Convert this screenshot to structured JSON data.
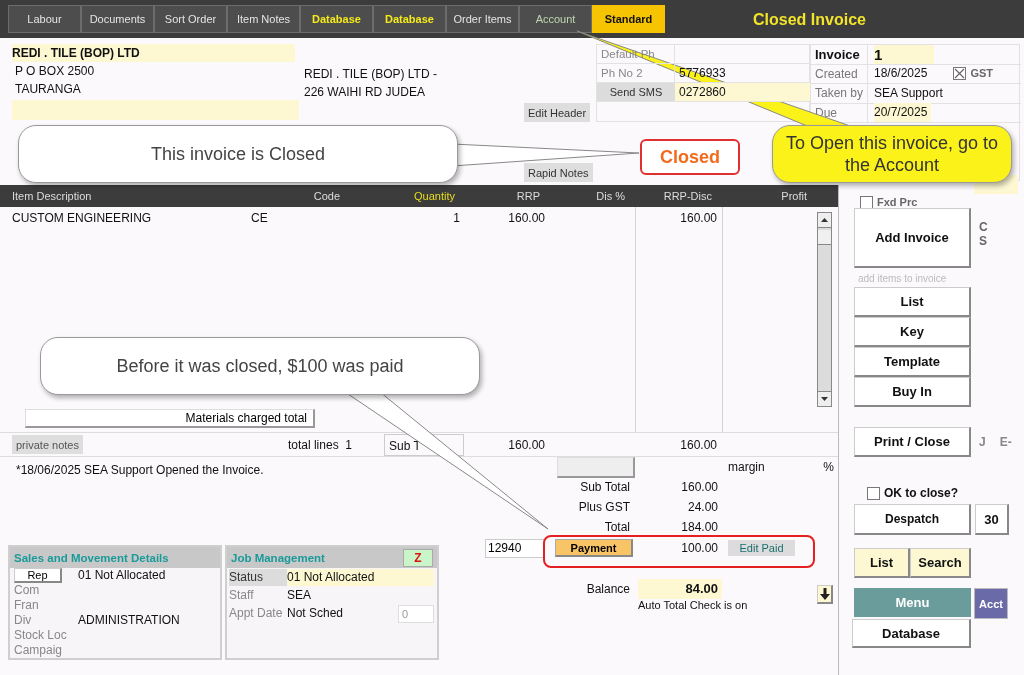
{
  "window": {
    "title": "Closed Invoice"
  },
  "tabs": [
    {
      "label": "Labour",
      "kind": "normal",
      "selected": false
    },
    {
      "label": "Documents",
      "kind": "normal",
      "selected": false
    },
    {
      "label": "Sort Order",
      "kind": "normal",
      "selected": false
    },
    {
      "label": "Item Notes",
      "kind": "normal",
      "selected": false
    },
    {
      "label": "Database",
      "kind": "database",
      "selected": false
    },
    {
      "label": "Database",
      "kind": "database",
      "selected": false
    },
    {
      "label": "Order Items",
      "kind": "normal",
      "selected": false
    },
    {
      "label": "Account",
      "kind": "account",
      "selected": false
    },
    {
      "label": "Standard",
      "kind": "normal",
      "selected": true
    }
  ],
  "customer": {
    "name": "REDI . TILE (BOP) LTD",
    "address_lines": [
      "P O BOX 2500",
      "TAURANGA"
    ],
    "site_lines": [
      "REDI . TILE (BOP) LTD -",
      "226 WAIHI RD JUDEA"
    ]
  },
  "header_buttons": [
    "Edit Header",
    "Rapid Notes"
  ],
  "phones": [
    {
      "label": "Default Ph",
      "kind": "label"
    },
    {
      "label": "Ph No 2",
      "value": "5776933",
      "kind": "label"
    },
    {
      "label": "Send SMS",
      "value": "0272860",
      "kind": "button"
    }
  ],
  "invoice_fields": [
    {
      "label": "Invoice",
      "value": "1",
      "kind": "key",
      "highlight": true
    },
    {
      "label": "Created",
      "value": "18/6/2025",
      "kind": "plain",
      "highlight": false,
      "gst": {
        "label": "GST",
        "checked": true
      }
    },
    {
      "label": "Taken by",
      "value": "SEA Support",
      "kind": "plain",
      "highlight": false
    },
    {
      "label": "Due",
      "value": "20/7/2025",
      "kind": "plain",
      "highlight": true
    }
  ],
  "status_badge": "Closed",
  "callouts": [
    {
      "text": "This invoice is Closed",
      "kind": "white"
    },
    {
      "text": "To Open this invoice, go to the Account",
      "kind": "yellow"
    },
    {
      "text": "Before it was closed, $100 was paid",
      "kind": "white"
    }
  ],
  "items_table": {
    "columns": [
      {
        "label": "Item Description",
        "highlight": false
      },
      {
        "label": "Code",
        "highlight": false
      },
      {
        "label": "Quantity",
        "highlight": true
      },
      {
        "label": "RRP",
        "highlight": false
      },
      {
        "label": "Dis %",
        "highlight": false
      },
      {
        "label": "RRP-Disc",
        "highlight": false
      },
      {
        "label": "Profit",
        "highlight": false
      }
    ],
    "rows": [
      {
        "description": "CUSTOM ENGINEERING",
        "code": "CE",
        "quantity": "1",
        "rrp": "160.00",
        "rrp_disc": "160.00"
      }
    ]
  },
  "materials_button": "Materials charged total",
  "summary_row": {
    "private_notes": "private notes",
    "total_lines_label": "total lines",
    "total_lines": "1",
    "sub_totals_label": "Sub T",
    "rrp_total": "160.00",
    "rrp_disc_total": "160.00"
  },
  "note": "*18/06/2025 SEA Support Opened the Invoice.",
  "totals": {
    "margin_label": "margin",
    "margin_unit": "%",
    "lines": [
      {
        "label": "Sub Total",
        "value": "160.00"
      },
      {
        "label": "Plus GST",
        "value": "24.00"
      },
      {
        "label": "Total",
        "value": "184.00"
      }
    ],
    "payment": {
      "reference": "12940",
      "button": "Payment",
      "amount": "100.00",
      "edit_button": "Edit Paid"
    },
    "balance": {
      "label": "Balance",
      "value": "84.00"
    },
    "auto_check": "Auto Total Check is on"
  },
  "sales_panel": {
    "title": "Sales and Movement Details",
    "rows": [
      {
        "label": "Rep",
        "kind": "button",
        "value": "01 Not Allocated"
      },
      {
        "label": "Com",
        "kind": "label"
      },
      {
        "label": "Fran",
        "kind": "label"
      },
      {
        "label": "Div",
        "kind": "label",
        "value": "ADMINISTRATION"
      },
      {
        "label": "Stock Loc",
        "kind": "label"
      },
      {
        "label": "Campaig",
        "kind": "label"
      }
    ]
  },
  "job_panel": {
    "title": "Job Management",
    "badge": "Z",
    "rows": [
      {
        "label": "Status",
        "value": "01 Not Allocated",
        "kind": "status"
      },
      {
        "label": "Staff",
        "value": "SEA",
        "kind": "label"
      },
      {
        "label": "Appt Date",
        "value": "Not Sched",
        "kind": "label",
        "count": "0"
      }
    ]
  },
  "side": {
    "fixed_price": {
      "label": "Fxd Prc",
      "checked": false
    },
    "add_button": "Add Invoice",
    "flags": [
      "C",
      "S"
    ],
    "hint": "add items to invoice",
    "item_buttons": [
      "List",
      "Key",
      "Template",
      "Buy In"
    ],
    "print_button": "Print / Close",
    "print_flags": [
      "J",
      "E-"
    ],
    "ok_to_close": {
      "label": "OK to close?",
      "checked": false
    },
    "despatch": "Despatch",
    "days": "30",
    "list_button": "List",
    "search_button": "Search",
    "menu_button": "Menu",
    "acct_button": "Acct",
    "database_button": "Database"
  }
}
